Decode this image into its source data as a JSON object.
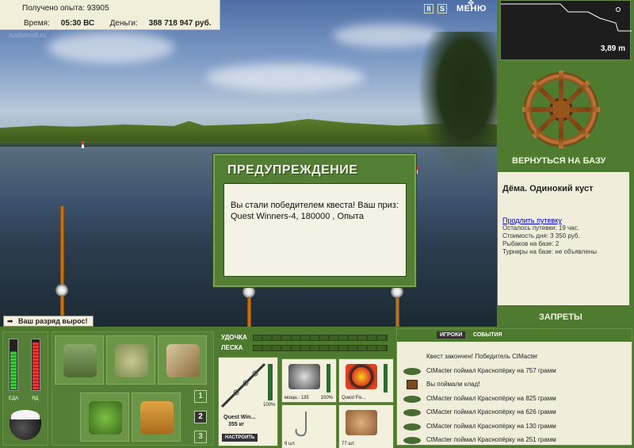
{
  "hud": {
    "experience_label": "Получено опыта: 93905",
    "time_label": "Время:",
    "time_value": "05:30 ВС",
    "money_label": "Деньги:",
    "money_value": "388 718 947 руб.",
    "watermark": "rusfishsoft.ru"
  },
  "topbar": {
    "pause_icon": "II",
    "sound_icon": "S",
    "menu_label": "МЕНЮ"
  },
  "notification": {
    "rank_up": "Ваш разряд вырос!"
  },
  "dialog": {
    "title": "ПРЕДУПРЕЖДЕНИЕ",
    "message": "Вы стали победителем квеста! Ваш приз: Quest Winners-4, 180000 , Опыта"
  },
  "depth": {
    "value": "3,89 m"
  },
  "base": {
    "back_label": "ВЕРНУТЬСЯ НА БАЗУ",
    "name": "Дёма. Одинокий куст",
    "renew_link": "Продлить путевку",
    "days_left": "Осталось путевки: 19 час.",
    "day_cost": "Стоимость дня: 3 350 руб.",
    "fishers": "Рыбаков на базе: 2",
    "tournaments": "Турниры на базе: не объявлены",
    "bans_label": "ЗАПРЕТЫ"
  },
  "gauges": {
    "food_label": "ЕДА",
    "poison_label": "ЯД",
    "food_level": 0.75,
    "poison_level": 0.92
  },
  "inventory": {
    "pages": [
      "1",
      "2",
      "3"
    ],
    "active_page": "2"
  },
  "tackle": {
    "rod_label": "УДОЧКА",
    "line_label": "ЛЕСКА",
    "rod_name": "Quest Win...",
    "rod_mass": "355 кг",
    "rod_pct": "100%",
    "tune_label": "НАСТРОИТЬ",
    "reel_power": "мощн.: 135",
    "reel_pct": "100%",
    "line_name": "Quest Fis...",
    "hooks_count": "9 шт.",
    "bait_count": "77 шт."
  },
  "events": {
    "tabs": [
      "ИГРОКИ",
      "СОБЫТИЯ"
    ],
    "items": [
      {
        "icon": "none",
        "text": "Квест закончен! Победитель CtMacter"
      },
      {
        "icon": "fish-icon",
        "text": "CtMacter поймал Краснопёрку на 757 грамм"
      },
      {
        "icon": "chest-icon",
        "text": "Вы поймали клад!"
      },
      {
        "icon": "fish-icon",
        "text": "CtMacter поймал Краснопёрку на 825 грамм"
      },
      {
        "icon": "fish-icon",
        "text": "CtMacter поймал Краснопёрку на 626 грамм"
      },
      {
        "icon": "fish-icon",
        "text": "CtMacter поймал Краснопёрку на 130 грамм"
      },
      {
        "icon": "fish-icon",
        "text": "CtMacter поймал Краснопёрку на 251 грамм"
      }
    ]
  }
}
